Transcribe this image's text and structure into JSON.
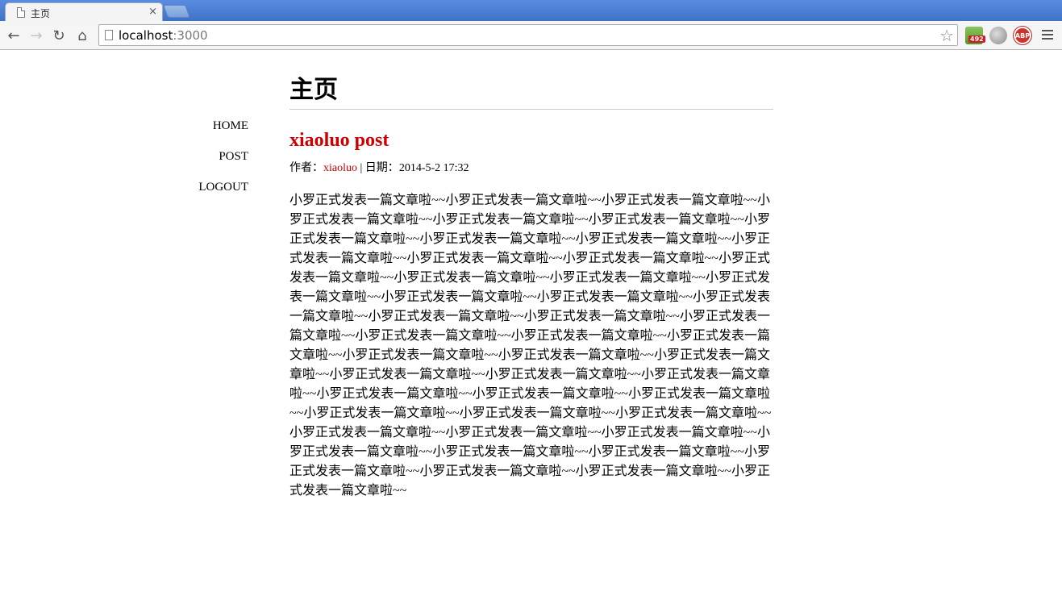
{
  "browser": {
    "tab_title": "主页",
    "tab_close": "×",
    "url_host": "localhost",
    "url_port": ":3000",
    "extension_badge": "492",
    "abp_label": "ABP",
    "icons": {
      "back": "←",
      "forward": "→",
      "reload": "↻",
      "home": "⌂",
      "star": "☆"
    }
  },
  "sidebar": {
    "items": [
      {
        "label": "HOME"
      },
      {
        "label": "POST"
      },
      {
        "label": "LOGOUT"
      }
    ]
  },
  "page": {
    "heading": "主页",
    "post": {
      "title": "xiaoluo post",
      "author_prefix": "作者：",
      "author": "xiaoluo",
      "date_prefix": " | 日期：",
      "date": "2014-5-2 17:32",
      "body": "小罗正式发表一篇文章啦~~小罗正式发表一篇文章啦~~小罗正式发表一篇文章啦~~小罗正式发表一篇文章啦~~小罗正式发表一篇文章啦~~小罗正式发表一篇文章啦~~小罗正式发表一篇文章啦~~小罗正式发表一篇文章啦~~小罗正式发表一篇文章啦~~小罗正式发表一篇文章啦~~小罗正式发表一篇文章啦~~小罗正式发表一篇文章啦~~小罗正式发表一篇文章啦~~小罗正式发表一篇文章啦~~小罗正式发表一篇文章啦~~小罗正式发表一篇文章啦~~小罗正式发表一篇文章啦~~小罗正式发表一篇文章啦~~小罗正式发表一篇文章啦~~小罗正式发表一篇文章啦~~小罗正式发表一篇文章啦~~小罗正式发表一篇文章啦~~小罗正式发表一篇文章啦~~小罗正式发表一篇文章啦~~小罗正式发表一篇文章啦~~小罗正式发表一篇文章啦~~小罗正式发表一篇文章啦~~小罗正式发表一篇文章啦~~小罗正式发表一篇文章啦~~小罗正式发表一篇文章啦~~小罗正式发表一篇文章啦~~小罗正式发表一篇文章啦~~小罗正式发表一篇文章啦~~小罗正式发表一篇文章啦~~小罗正式发表一篇文章啦~~小罗正式发表一篇文章啦~~小罗正式发表一篇文章啦~~小罗正式发表一篇文章啦~~小罗正式发表一篇文章啦~~小罗正式发表一篇文章啦~~小罗正式发表一篇文章啦~~小罗正式发表一篇文章啦~~小罗正式发表一篇文章啦~~小罗正式发表一篇文章啦~~小罗正式发表一篇文章啦~~小罗正式发表一篇文章啦~~小罗正式发表一篇文章啦~~"
    }
  }
}
